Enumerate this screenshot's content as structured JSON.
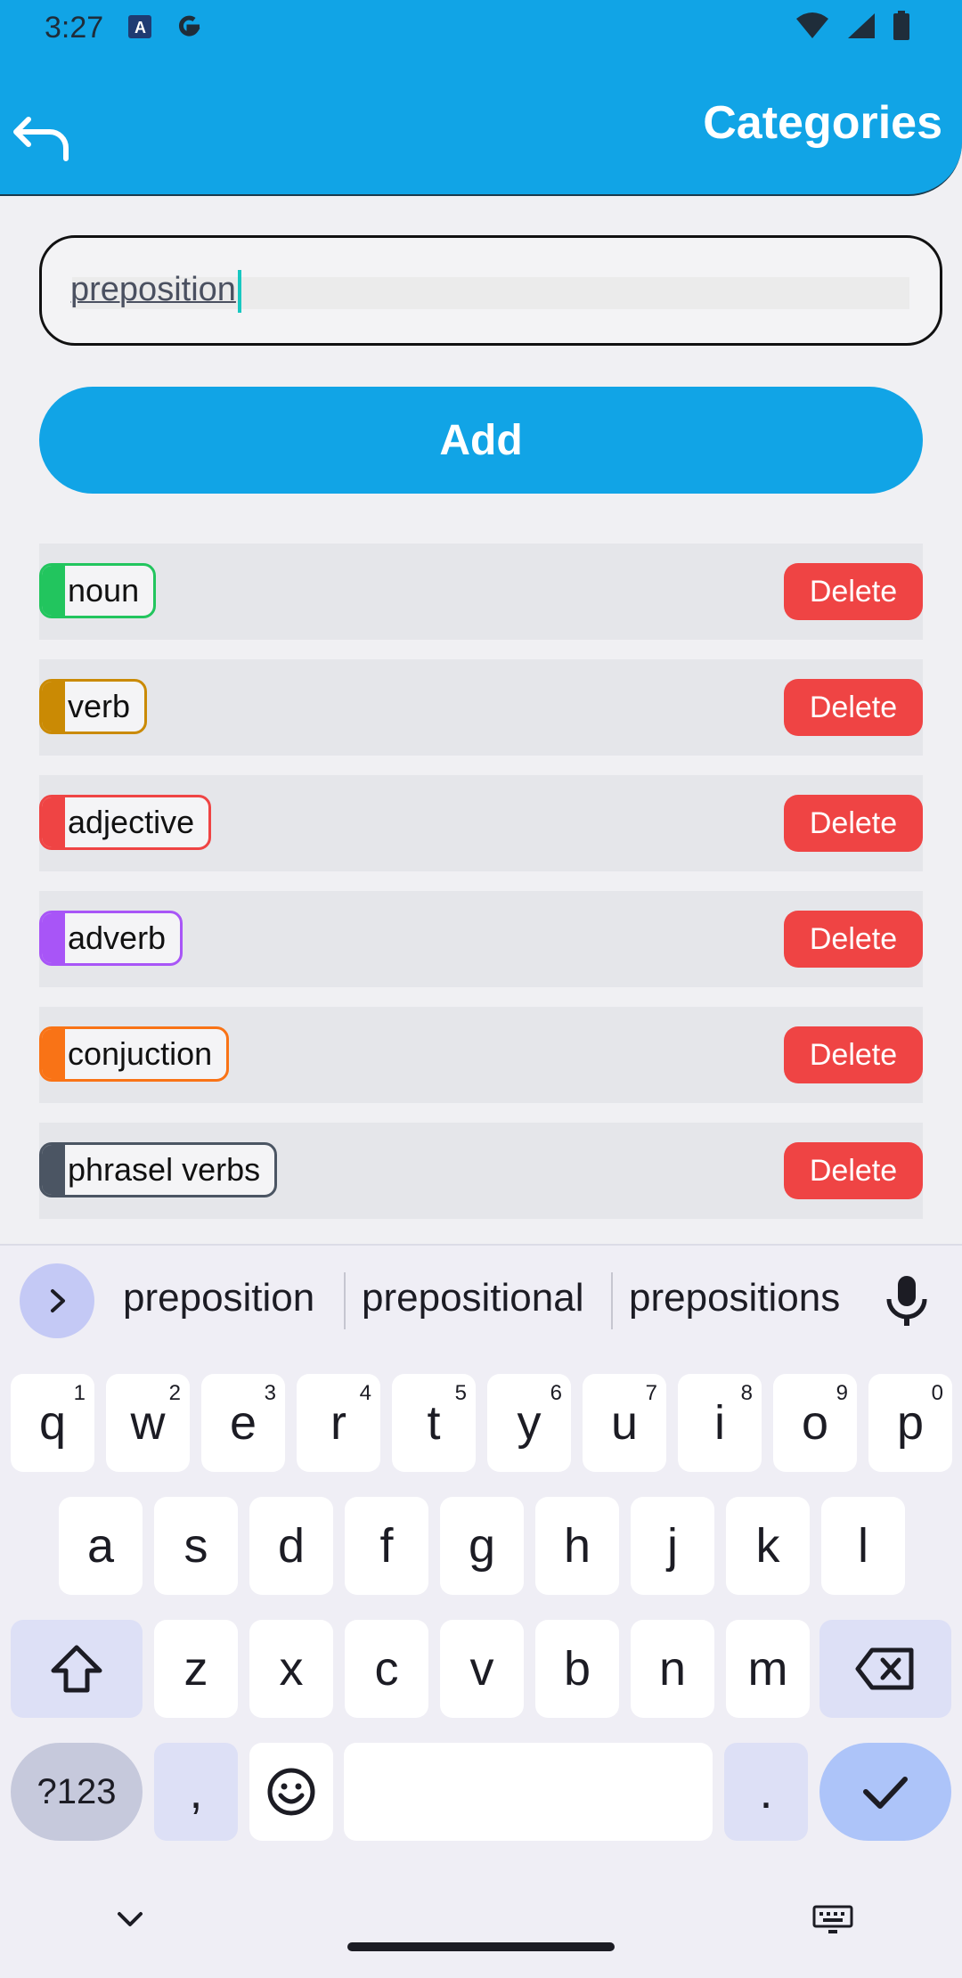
{
  "status_bar": {
    "time": "3:27"
  },
  "header": {
    "title": "Categories"
  },
  "input": {
    "value": "preposition"
  },
  "add_button": {
    "label": "Add"
  },
  "categories": [
    {
      "label": "noun",
      "color": "#22c55e"
    },
    {
      "label": "verb",
      "color": "#ca8a04"
    },
    {
      "label": "adjective",
      "color": "#ef4444"
    },
    {
      "label": "adverb",
      "color": "#a855f7"
    },
    {
      "label": "conjuction",
      "color": "#f97316"
    },
    {
      "label": "phrasel verbs",
      "color": "#4b5563"
    }
  ],
  "delete_label": "Delete",
  "keyboard": {
    "suggestions": [
      "preposition",
      "prepositional",
      "prepositions"
    ],
    "row1": [
      {
        "k": "q",
        "h": "1"
      },
      {
        "k": "w",
        "h": "2"
      },
      {
        "k": "e",
        "h": "3"
      },
      {
        "k": "r",
        "h": "4"
      },
      {
        "k": "t",
        "h": "5"
      },
      {
        "k": "y",
        "h": "6"
      },
      {
        "k": "u",
        "h": "7"
      },
      {
        "k": "i",
        "h": "8"
      },
      {
        "k": "o",
        "h": "9"
      },
      {
        "k": "p",
        "h": "0"
      }
    ],
    "row2": [
      "a",
      "s",
      "d",
      "f",
      "g",
      "h",
      "j",
      "k",
      "l"
    ],
    "row3": [
      "z",
      "x",
      "c",
      "v",
      "b",
      "n",
      "m"
    ],
    "symbols": "?123",
    "comma": ",",
    "period": ".",
    "icons": {
      "shift": "shift-icon",
      "backspace": "backspace-icon",
      "emoji": "emoji-icon",
      "enter": "check-icon",
      "mic": "mic-icon",
      "expand": "chevron-right-icon"
    }
  },
  "colors": {
    "primary": "#11a4e6",
    "danger": "#ef4444"
  }
}
